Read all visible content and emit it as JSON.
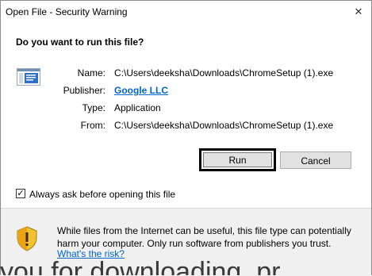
{
  "window": {
    "title": "Open File - Security Warning",
    "close_glyph": "✕"
  },
  "dialog": {
    "question": "Do you want to run this file?",
    "fields": {
      "name_label": "Name:",
      "name_value": "C:\\Users\\deeksha\\Downloads\\ChromeSetup (1).exe",
      "publisher_label": "Publisher:",
      "publisher_value": "Google LLC",
      "type_label": "Type:",
      "type_value": "Application",
      "from_label": "From:",
      "from_value": "C:\\Users\\deeksha\\Downloads\\ChromeSetup (1).exe"
    },
    "buttons": {
      "run_label": "Run",
      "cancel_label": "Cancel"
    },
    "checkbox": {
      "label": "Always ask before opening this file",
      "checked": true,
      "check_glyph": "✓"
    },
    "footer": {
      "message": "While files from the Internet can be useful, this file type can potentially harm your computer. Only run software from publishers you trust.",
      "link_text": "What's the risk?"
    }
  },
  "background": {
    "partial_text": "you for downloading. pr"
  },
  "colors": {
    "link": "#0066cc",
    "button_face": "#e1e1e1",
    "footer_bg": "#f0f0f0",
    "shield_yellow": "#f2c230",
    "shield_orange": "#e8a317"
  }
}
